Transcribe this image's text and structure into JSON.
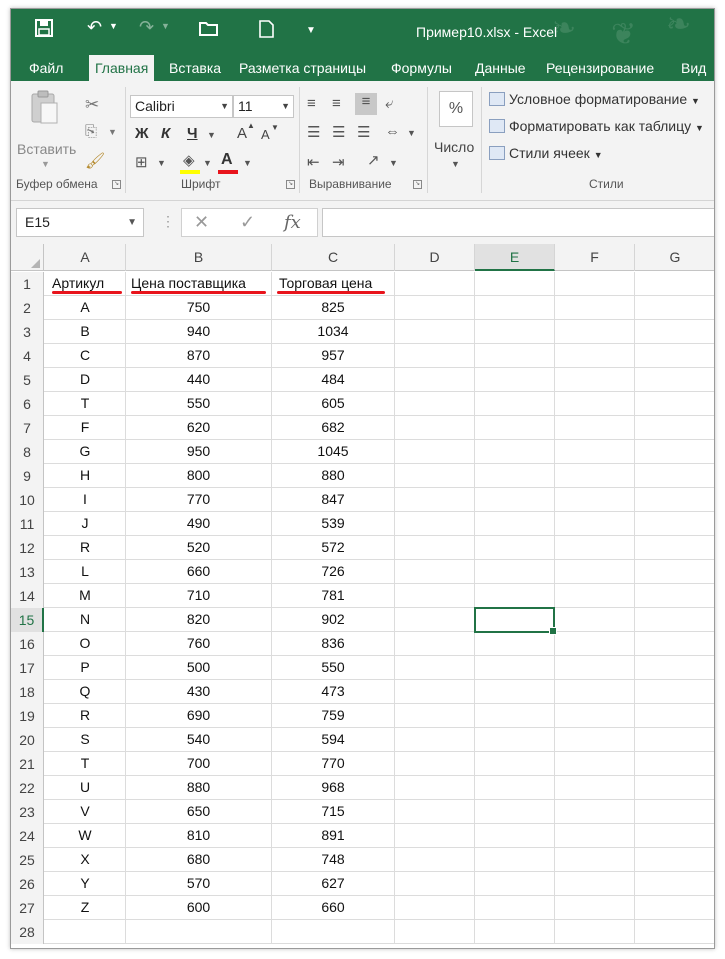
{
  "titlebar": {
    "title": "Пример10.xlsx - Excel",
    "accent": "#217346"
  },
  "tabs": [
    {
      "label": "Файл",
      "active": false
    },
    {
      "label": "Главная",
      "active": true
    },
    {
      "label": "Вставка",
      "active": false
    },
    {
      "label": "Разметка страницы",
      "active": false
    },
    {
      "label": "Формулы",
      "active": false
    },
    {
      "label": "Данные",
      "active": false
    },
    {
      "label": "Рецензирование",
      "active": false
    },
    {
      "label": "Вид",
      "active": false
    }
  ],
  "ribbon": {
    "clipboard": {
      "paste_label": "Вставить",
      "group_label": "Буфер обмена"
    },
    "font": {
      "name": "Calibri",
      "size": "11",
      "bold": "Ж",
      "italic": "К",
      "underline": "Ч",
      "grow": "A",
      "shrink": "A",
      "color_letter": "A",
      "group_label": "Шрифт",
      "highlight_color": "#ffff00",
      "font_color": "#e8141c"
    },
    "alignment": {
      "group_label": "Выравнивание"
    },
    "number": {
      "label": "Число",
      "percent": "%"
    },
    "styles": {
      "conditional": "Условное форматирование",
      "format_table": "Форматировать как таблицу",
      "cell_styles": "Стили ячеек",
      "group_label": "Стили"
    }
  },
  "formula_bar": {
    "name_box": "E15",
    "cancel": "✕",
    "enter": "✓",
    "fx": "fx",
    "value": ""
  },
  "sheet": {
    "columns": [
      "A",
      "B",
      "C",
      "D",
      "E",
      "F",
      "G"
    ],
    "selected_column": "E",
    "selected_row": "15",
    "rows": [
      {
        "n": "1",
        "a": "Артикул",
        "b": "Цена поставщика",
        "c": "Торговая цена"
      },
      {
        "n": "2",
        "a": "A",
        "b": "750",
        "c": "825"
      },
      {
        "n": "3",
        "a": "B",
        "b": "940",
        "c": "1034"
      },
      {
        "n": "4",
        "a": "C",
        "b": "870",
        "c": "957"
      },
      {
        "n": "5",
        "a": "D",
        "b": "440",
        "c": "484"
      },
      {
        "n": "6",
        "a": "T",
        "b": "550",
        "c": "605"
      },
      {
        "n": "7",
        "a": "F",
        "b": "620",
        "c": "682"
      },
      {
        "n": "8",
        "a": "G",
        "b": "950",
        "c": "1045"
      },
      {
        "n": "9",
        "a": "H",
        "b": "800",
        "c": "880"
      },
      {
        "n": "10",
        "a": "I",
        "b": "770",
        "c": "847"
      },
      {
        "n": "11",
        "a": "J",
        "b": "490",
        "c": "539"
      },
      {
        "n": "12",
        "a": "R",
        "b": "520",
        "c": "572"
      },
      {
        "n": "13",
        "a": "L",
        "b": "660",
        "c": "726"
      },
      {
        "n": "14",
        "a": "M",
        "b": "710",
        "c": "781"
      },
      {
        "n": "15",
        "a": "N",
        "b": "820",
        "c": "902"
      },
      {
        "n": "16",
        "a": "O",
        "b": "760",
        "c": "836"
      },
      {
        "n": "17",
        "a": "P",
        "b": "500",
        "c": "550"
      },
      {
        "n": "18",
        "a": "Q",
        "b": "430",
        "c": "473"
      },
      {
        "n": "19",
        "a": "R",
        "b": "690",
        "c": "759"
      },
      {
        "n": "20",
        "a": "S",
        "b": "540",
        "c": "594"
      },
      {
        "n": "21",
        "a": "T",
        "b": "700",
        "c": "770"
      },
      {
        "n": "22",
        "a": "U",
        "b": "880",
        "c": "968"
      },
      {
        "n": "23",
        "a": "V",
        "b": "650",
        "c": "715"
      },
      {
        "n": "24",
        "a": "W",
        "b": "810",
        "c": "891"
      },
      {
        "n": "25",
        "a": "X",
        "b": "680",
        "c": "748"
      },
      {
        "n": "26",
        "a": "Y",
        "b": "570",
        "c": "627"
      },
      {
        "n": "27",
        "a": "Z",
        "b": "600",
        "c": "660"
      },
      {
        "n": "28",
        "a": "",
        "b": "",
        "c": ""
      }
    ]
  }
}
